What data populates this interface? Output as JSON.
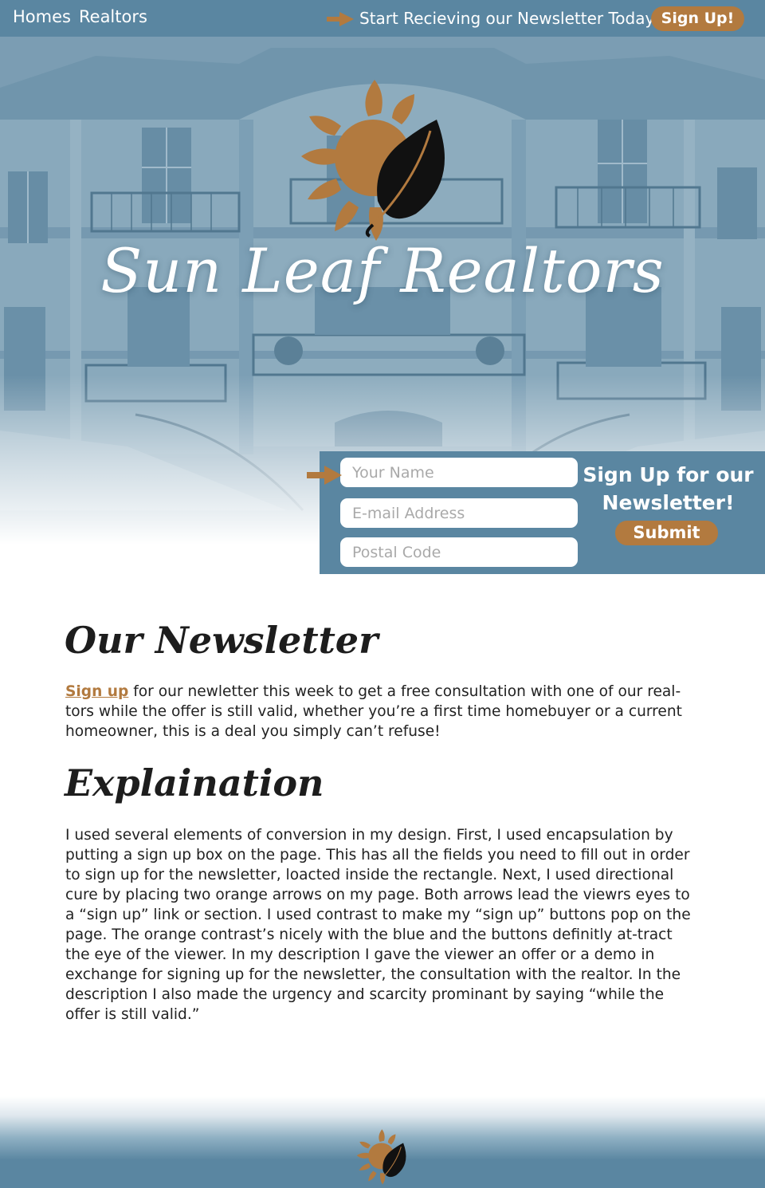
{
  "nav": {
    "home_label": "Homes",
    "realtors_label": "Realtors",
    "promo_text": "Start Recieving our Newsletter Today!",
    "signup_label": "Sign Up!"
  },
  "brand": {
    "title": "Sun Leaf Realtors",
    "logo_icon": "sun-leaf-logo-icon"
  },
  "signup_form": {
    "name_placeholder": "Your Name",
    "email_placeholder": "E-mail Address",
    "postal_placeholder": "Postal Code",
    "heading": "Sign Up for our Newsletter!",
    "submit_label": "Submit"
  },
  "newsletter": {
    "title": "Our Newsletter",
    "link_text": "Sign up",
    "body": " for our newletter this week to get a free consultation with one of our real-tors while the offer is still valid, whether you’re a first time homebuyer or a current homeowner, this is a deal you simply can’t refuse!"
  },
  "explanation": {
    "title": "Explaination",
    "body": "I used several elements of conversion in my design. First, I used encapsulation by putting a sign up box on the page. This has all the fields you need to fill out in order to sign up for the newsletter, loacted inside the rectangle. Next, I used directional cure by placing two orange arrows on my page. Both arrows lead the viewrs eyes to a “sign up” link or section. I used contrast to make my “sign up” buttons pop on the page. The orange contrast’s nicely with the blue and the buttons definitly at-tract the eye of the viewer. In my description I gave the viewer an offer or a demo in exchange for signing up for the newsletter, the consultation with the realtor. In the description I also made the urgency and scarcity prominant by saying “while the offer is still valid.”"
  },
  "colors": {
    "primary_blue": "#5a86a1",
    "accent_orange": "#b27a3f",
    "leaf_black": "#111111"
  }
}
